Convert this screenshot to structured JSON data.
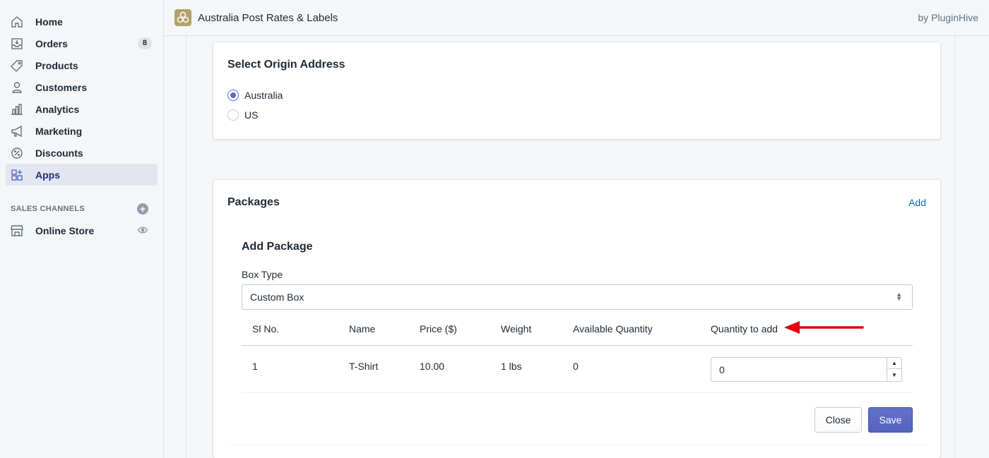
{
  "sidebar": {
    "items": [
      {
        "label": "Home",
        "icon": "home-icon"
      },
      {
        "label": "Orders",
        "icon": "orders-icon",
        "badge": "8"
      },
      {
        "label": "Products",
        "icon": "tag-icon"
      },
      {
        "label": "Customers",
        "icon": "person-icon"
      },
      {
        "label": "Analytics",
        "icon": "bar-chart-icon"
      },
      {
        "label": "Marketing",
        "icon": "megaphone-icon"
      },
      {
        "label": "Discounts",
        "icon": "discount-icon"
      },
      {
        "label": "Apps",
        "icon": "apps-icon",
        "active": true
      }
    ],
    "sales_channels_title": "SALES CHANNELS",
    "channels": [
      {
        "label": "Online Store",
        "icon": "store-icon"
      }
    ]
  },
  "topbar": {
    "app_title": "Australia Post Rates & Labels",
    "byline": "by PluginHive"
  },
  "origin": {
    "title": "Select Origin Address",
    "options": [
      {
        "label": "Australia",
        "checked": true
      },
      {
        "label": "US",
        "checked": false
      }
    ]
  },
  "packages": {
    "title": "Packages",
    "add_label": "Add",
    "add_package": {
      "title": "Add Package",
      "box_type_label": "Box Type",
      "box_type_value": "Custom Box",
      "table": {
        "headers": [
          "Sl No.",
          "Name",
          "Price ($)",
          "Weight",
          "Available Quantity",
          "Quantity to add"
        ],
        "rows": [
          {
            "sl_no": "1",
            "name": "T-Shirt",
            "price": "10.00",
            "weight": "1 lbs",
            "available": "0",
            "quantity": "0"
          }
        ]
      },
      "close_label": "Close",
      "save_label": "Save"
    }
  },
  "colors": {
    "accent": "#5c6ac4",
    "link": "#006fbb",
    "annotation_arrow": "#e3000f"
  }
}
